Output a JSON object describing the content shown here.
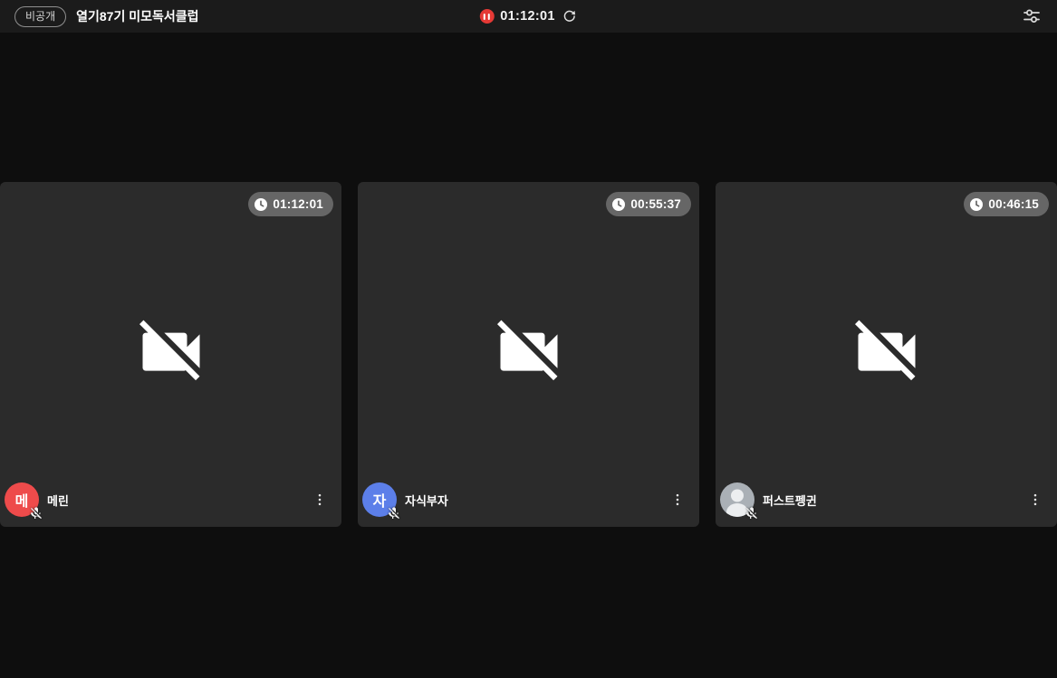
{
  "colors": {
    "page_bg": "#0e0e0e",
    "topbar_bg": "#1b1b1b",
    "tile_bg": "#2b2b2b",
    "pause_red": "#e53935",
    "timer_badge_bg": "rgba(255,255,255,0.28)"
  },
  "topbar": {
    "privacy_badge": "비공개",
    "title": "열기87기 미모독서클럽",
    "timer": "01:12:01",
    "icons": {
      "pause": "pause-icon",
      "refresh": "refresh-icon",
      "filters": "tune-sliders-icon"
    }
  },
  "participants": [
    {
      "name": "메린",
      "initial": "메",
      "avatar_color": "#ee4b4b",
      "timer": "01:12:01",
      "camera_off": true,
      "mic_muted": true
    },
    {
      "name": "자식부자",
      "initial": "자",
      "avatar_color": "#5c7fe9",
      "timer": "00:55:37",
      "camera_off": true,
      "mic_muted": true
    },
    {
      "name": "퍼스트펭귄",
      "initial": "",
      "avatar_color": "#aab0b6",
      "timer": "00:46:15",
      "camera_off": true,
      "mic_muted": true
    }
  ]
}
